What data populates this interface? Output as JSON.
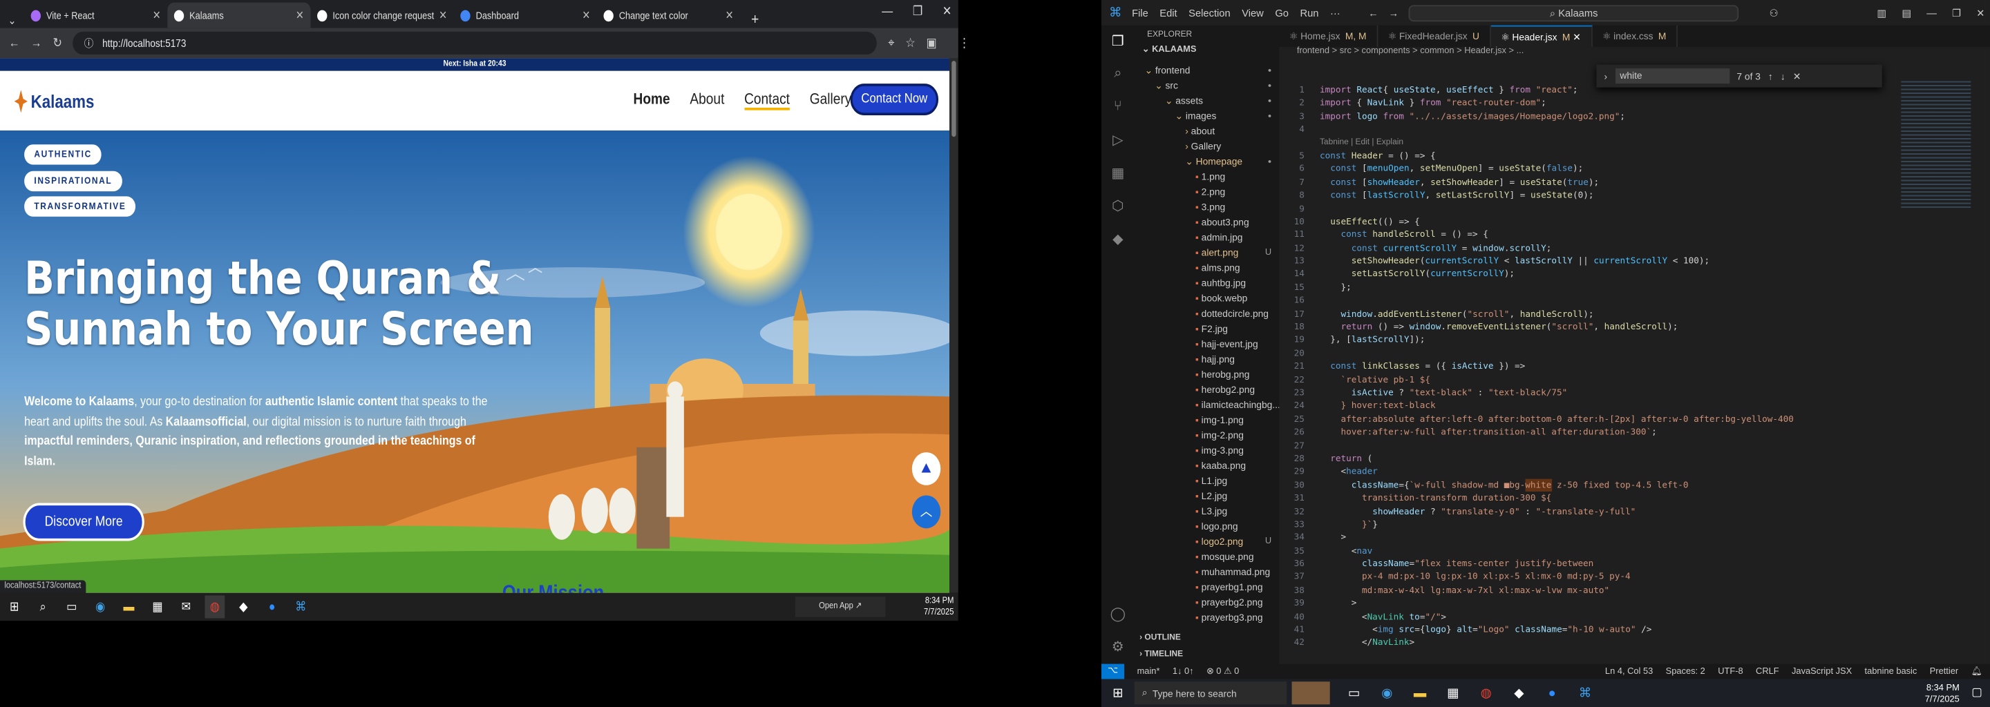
{
  "browser": {
    "tabs": [
      {
        "title": "Vite + React",
        "color": "#a86bf7"
      },
      {
        "title": "Kalaams",
        "color": "#ffffff"
      },
      {
        "title": "Icon color change request",
        "color": "#ffffff"
      },
      {
        "title": "Dashboard",
        "color": "#4285f4"
      },
      {
        "title": "Change text color",
        "color": "#ffffff"
      }
    ],
    "url": "http://localhost:5173",
    "status_url": "localhost:5173/contact"
  },
  "site": {
    "banner": "Next: Isha at 20:43",
    "logo": "Kalaams",
    "nav": [
      "Home",
      "About",
      "Contact",
      "Gallery"
    ],
    "cta": "Contact Now",
    "pills": [
      "AUTHENTIC",
      "INSPIRATIONAL",
      "TRANSFORMATIVE"
    ],
    "headline_1": "Bringing the Quran &",
    "headline_2": "Sunnah to Your Screen",
    "para": [
      {
        "b": "Welcome to Kalaams",
        "t": ", your go-to destination for "
      },
      {
        "b": "authentic Islamic content",
        "t": " that speaks to the heart and uplifts the soul. As "
      },
      {
        "b": "Kalaamsofficial",
        "t": ", our digital mission is to nurture faith through "
      },
      {
        "b": "impactful reminders, Quranic inspiration, and reflections grounded in the teachings of Islam.",
        "t": ""
      }
    ],
    "button": "Discover More",
    "section_peek": "Our Mission"
  },
  "taskbar_left": {
    "open_app": "Open App ↗",
    "time": "8:34 PM",
    "date": "7/7/2025"
  },
  "vscode": {
    "menu": [
      "File",
      "Edit",
      "Selection",
      "View",
      "Go",
      "Run",
      "···"
    ],
    "search": "Kalaams",
    "explorer": "EXPLORER",
    "project": "KALAAMS",
    "tree": [
      {
        "name": "frontend",
        "d": 1,
        "type": "open",
        "mark": "dot"
      },
      {
        "name": "src",
        "d": 2,
        "type": "open",
        "mark": "dot"
      },
      {
        "name": "assets",
        "d": 3,
        "type": "open",
        "mark": "dot"
      },
      {
        "name": "images",
        "d": 4,
        "type": "open",
        "mark": "dot"
      },
      {
        "name": "about",
        "d": 5,
        "type": "closed",
        "mark": ""
      },
      {
        "name": "Gallery",
        "d": 5,
        "type": "closed",
        "mark": ""
      },
      {
        "name": "Homepage",
        "d": 5,
        "type": "open",
        "mark": "dot",
        "mod": true
      },
      {
        "name": "1.png",
        "d": 6,
        "type": "file"
      },
      {
        "name": "2.png",
        "d": 6,
        "type": "file"
      },
      {
        "name": "3.png",
        "d": 6,
        "type": "file"
      },
      {
        "name": "about3.png",
        "d": 6,
        "type": "file"
      },
      {
        "name": "admin.jpg",
        "d": 6,
        "type": "file"
      },
      {
        "name": "alert.png",
        "d": 6,
        "type": "file",
        "mark": "U",
        "mod": true
      },
      {
        "name": "alms.png",
        "d": 6,
        "type": "file"
      },
      {
        "name": "auhtbg.jpg",
        "d": 6,
        "type": "file"
      },
      {
        "name": "book.webp",
        "d": 6,
        "type": "file"
      },
      {
        "name": "dottedcircle.png",
        "d": 6,
        "type": "file"
      },
      {
        "name": "F2.jpg",
        "d": 6,
        "type": "file"
      },
      {
        "name": "hajj-event.jpg",
        "d": 6,
        "type": "file"
      },
      {
        "name": "hajj.png",
        "d": 6,
        "type": "file"
      },
      {
        "name": "herobg.png",
        "d": 6,
        "type": "file"
      },
      {
        "name": "herobg2.png",
        "d": 6,
        "type": "file"
      },
      {
        "name": "ilamicteachingbg...",
        "d": 6,
        "type": "file"
      },
      {
        "name": "img-1.png",
        "d": 6,
        "type": "file"
      },
      {
        "name": "img-2.png",
        "d": 6,
        "type": "file"
      },
      {
        "name": "img-3.png",
        "d": 6,
        "type": "file"
      },
      {
        "name": "kaaba.png",
        "d": 6,
        "type": "file"
      },
      {
        "name": "L1.jpg",
        "d": 6,
        "type": "file"
      },
      {
        "name": "L2.jpg",
        "d": 6,
        "type": "file"
      },
      {
        "name": "L3.jpg",
        "d": 6,
        "type": "file"
      },
      {
        "name": "logo.png",
        "d": 6,
        "type": "file"
      },
      {
        "name": "logo2.png",
        "d": 6,
        "type": "file",
        "mark": "U",
        "mod": true
      },
      {
        "name": "mosque.png",
        "d": 6,
        "type": "file"
      },
      {
        "name": "muhammad.png",
        "d": 6,
        "type": "file"
      },
      {
        "name": "prayerbg1.png",
        "d": 6,
        "type": "file"
      },
      {
        "name": "prayerbg2.png",
        "d": 6,
        "type": "file"
      },
      {
        "name": "prayerbg3.png",
        "d": 6,
        "type": "file"
      }
    ],
    "outline": "OUTLINE",
    "timeline": "TIMELINE",
    "tabs": [
      {
        "name": "Home.jsx",
        "suf": "M, M"
      },
      {
        "name": "FixedHeader.jsx",
        "suf": "U"
      },
      {
        "name": "Header.jsx",
        "suf": "M",
        "active": true
      },
      {
        "name": "index.css",
        "suf": "M"
      }
    ],
    "breadcrumb": "frontend > src > components > common > Header.jsx > ...",
    "find": {
      "query": "white",
      "count": "7 of 3"
    },
    "tabnine": "Tabnine | Edit | Explain",
    "status": {
      "branch": "main*",
      "sync": "1↓ 0↑",
      "errors": "⊗ 0 ⚠ 0",
      "pos": "Ln 4, Col 53",
      "spaces": "Spaces: 2",
      "enc": "UTF-8",
      "eol": "CRLF",
      "lang": "JavaScript JSX",
      "tabnine": "tabnine basic",
      "prettier": "Prettier"
    },
    "taskbar": {
      "search": "Type here to search",
      "time": "8:34 PM",
      "date": "7/7/2025"
    }
  }
}
